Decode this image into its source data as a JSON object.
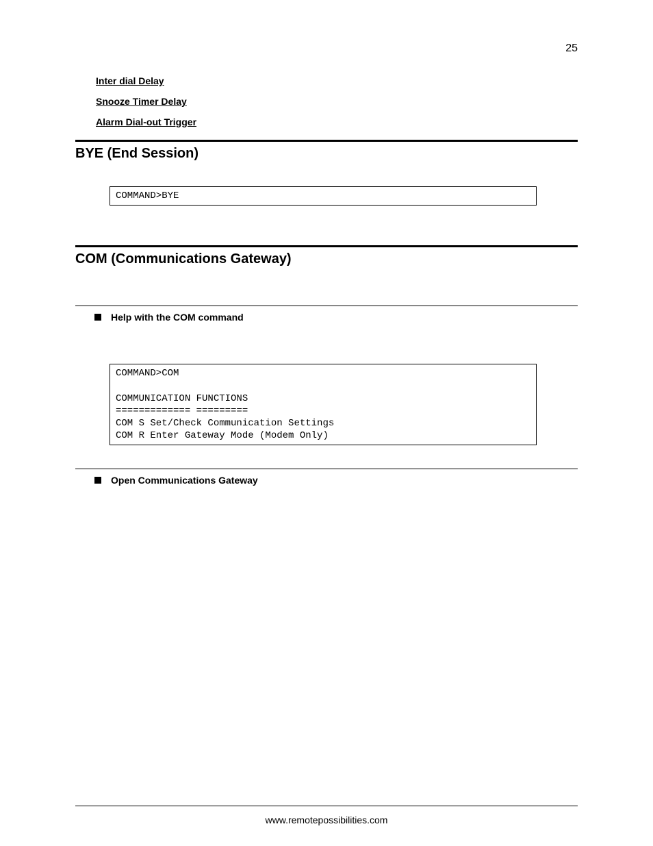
{
  "page_number": "25",
  "links": {
    "inter_dial_delay": "Inter dial Delay",
    "snooze_timer_delay": "Snooze Timer Delay",
    "alarm_dial_out_trigger": "Alarm Dial-out Trigger"
  },
  "sections": {
    "bye": {
      "title": "BYE (End Session)",
      "code": "COMMAND>BYE"
    },
    "com": {
      "title": "COM (Communications Gateway)",
      "sub1": {
        "heading": "Help with the COM command",
        "code": "COMMAND>COM\n\nCOMMUNICATION FUNCTIONS\n============= =========\nCOM S Set/Check Communication Settings\nCOM R Enter Gateway Mode (Modem Only)"
      },
      "sub2": {
        "heading": "Open Communications Gateway"
      }
    }
  },
  "footer": "www.remotepossibilities.com"
}
